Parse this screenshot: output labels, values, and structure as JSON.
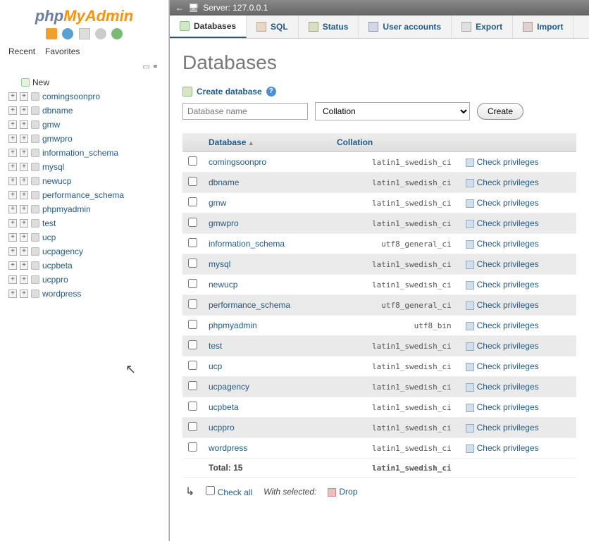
{
  "logo": {
    "part1": "php",
    "part2": "MyAdmin"
  },
  "side_tabs": {
    "recent": "Recent",
    "favorites": "Favorites"
  },
  "tree": {
    "new_label": "New",
    "items": [
      "comingsoonpro",
      "dbname",
      "gmw",
      "gmwpro",
      "information_schema",
      "mysql",
      "newucp",
      "performance_schema",
      "phpmyadmin",
      "test",
      "ucp",
      "ucpagency",
      "ucpbeta",
      "ucppro",
      "wordpress"
    ]
  },
  "server_bar": {
    "label": "Server: 127.0.0.1"
  },
  "nav": {
    "databases": "Databases",
    "sql": "SQL",
    "status": "Status",
    "users": "User accounts",
    "export": "Export",
    "import": "Import"
  },
  "page_title": "Databases",
  "create": {
    "heading": "Create database",
    "placeholder": "Database name",
    "collation_placeholder": "Collation",
    "button": "Create"
  },
  "table": {
    "headers": {
      "database": "Database",
      "collation": "Collation"
    },
    "privileges_label": "Check privileges",
    "rows": [
      {
        "name": "comingsoonpro",
        "collation": "latin1_swedish_ci"
      },
      {
        "name": "dbname",
        "collation": "latin1_swedish_ci"
      },
      {
        "name": "gmw",
        "collation": "latin1_swedish_ci"
      },
      {
        "name": "gmwpro",
        "collation": "latin1_swedish_ci"
      },
      {
        "name": "information_schema",
        "collation": "utf8_general_ci"
      },
      {
        "name": "mysql",
        "collation": "latin1_swedish_ci"
      },
      {
        "name": "newucp",
        "collation": "latin1_swedish_ci"
      },
      {
        "name": "performance_schema",
        "collation": "utf8_general_ci"
      },
      {
        "name": "phpmyadmin",
        "collation": "utf8_bin"
      },
      {
        "name": "test",
        "collation": "latin1_swedish_ci"
      },
      {
        "name": "ucp",
        "collation": "latin1_swedish_ci"
      },
      {
        "name": "ucpagency",
        "collation": "latin1_swedish_ci"
      },
      {
        "name": "ucpbeta",
        "collation": "latin1_swedish_ci"
      },
      {
        "name": "ucppro",
        "collation": "latin1_swedish_ci"
      },
      {
        "name": "wordpress",
        "collation": "latin1_swedish_ci"
      }
    ],
    "total_label": "Total: 15",
    "total_collation": "latin1_swedish_ci"
  },
  "footer": {
    "check_all": "Check all",
    "with_selected": "With selected:",
    "drop": "Drop"
  }
}
